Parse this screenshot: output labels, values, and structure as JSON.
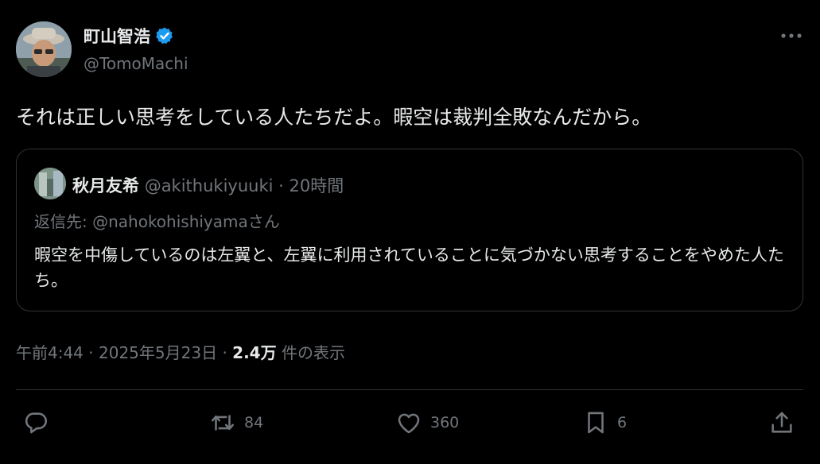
{
  "author": {
    "display_name": "町山智浩",
    "handle": "@TomoMachi",
    "verified_icon": "verified-badge-icon"
  },
  "more_icon": "more-icon",
  "tweet_text": "それは正しい思考をしている人たちだよ。暇空は裁判全敗なんだから。",
  "quote": {
    "display_name": "秋月友希",
    "handle": "@akithukiyuuki",
    "separator": "·",
    "time": "20時間",
    "reply_to": "返信先: @nahokohishiyamaさん",
    "text": "暇空を中傷しているのは左翼と、左翼に利用されていることに気づかない思考することをやめた人たち。"
  },
  "meta": {
    "time": "午前4:44",
    "sep1": "·",
    "date": "2025年5月23日",
    "sep2": "·",
    "views": "2.4万",
    "views_label": "件の表示"
  },
  "actions": {
    "reply": {
      "icon": "reply-icon",
      "count": ""
    },
    "retweet": {
      "icon": "retweet-icon",
      "count": "84"
    },
    "like": {
      "icon": "heart-icon",
      "count": "360"
    },
    "bookmark": {
      "icon": "bookmark-icon",
      "count": "6"
    },
    "share": {
      "icon": "share-icon",
      "count": ""
    }
  },
  "colors": {
    "background": "#000000",
    "text": "#e7e9ea",
    "muted": "#71767b",
    "border": "#2f3336",
    "verified": "#1d9bf0"
  }
}
